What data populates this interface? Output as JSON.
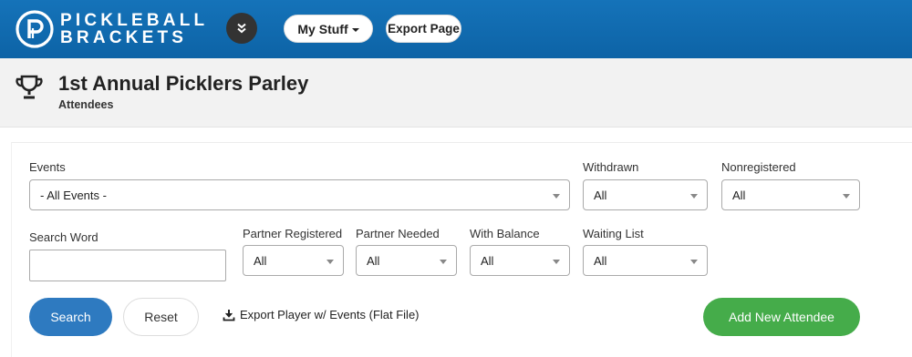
{
  "header": {
    "brand_line1": "PICKLEBALL",
    "brand_line2": "BRACKETS",
    "my_stuff_label": "My Stuff",
    "export_page_label": "Export Page"
  },
  "page": {
    "title": "1st Annual Picklers Parley",
    "subtitle": "Attendees"
  },
  "filters": {
    "events": {
      "label": "Events",
      "value": "- All Events -"
    },
    "withdrawn": {
      "label": "Withdrawn",
      "value": "All"
    },
    "nonregistered": {
      "label": "Nonregistered",
      "value": "All"
    },
    "search_word": {
      "label": "Search Word",
      "value": ""
    },
    "partner_registered": {
      "label": "Partner Registered",
      "value": "All"
    },
    "partner_needed": {
      "label": "Partner Needed",
      "value": "All"
    },
    "with_balance": {
      "label": "With Balance",
      "value": "All"
    },
    "waiting_list": {
      "label": "Waiting List",
      "value": "All"
    }
  },
  "actions": {
    "search_label": "Search",
    "reset_label": "Reset",
    "export_flat_label": "Export Player w/ Events (Flat File)",
    "add_attendee_label": "Add New Attendee"
  },
  "colors": {
    "header_blue": "#1570b6",
    "search_blue": "#2e7ac0",
    "add_green": "#45ac4a"
  }
}
